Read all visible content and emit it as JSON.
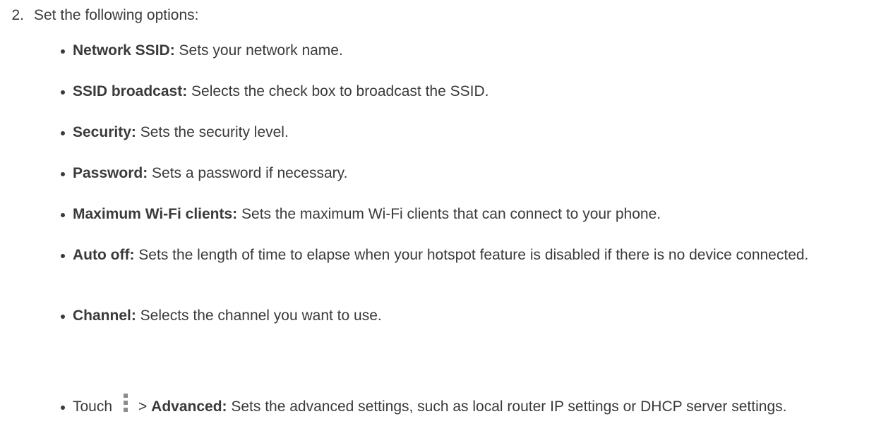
{
  "step": {
    "number": "2.",
    "text": "Set the following options:"
  },
  "options": [
    {
      "term": "Network SSID:",
      "description": " Sets your network name."
    },
    {
      "term": "SSID broadcast:",
      "description": " Selects the check box to broadcast the SSID."
    },
    {
      "term": "Security:",
      "description": " Sets the security level."
    },
    {
      "term": "Password:",
      "description": " Sets a password if necessary."
    },
    {
      "term": "Maximum Wi-Fi clients:",
      "description": " Sets the maximum Wi-Fi clients that can connect to your phone."
    },
    {
      "term": "Auto off:",
      "description": " Sets the length of time to elapse when your hotspot feature is disabled if there is no device connected."
    },
    {
      "term": "Channel:",
      "description": " Selects the channel you want to use."
    }
  ],
  "touch_option": {
    "prefix": "Touch",
    "icon": "more-options-vertical-icon",
    "separator": ">",
    "term": "Advanced:",
    "description": " Sets the advanced settings, such as local router IP settings or DHCP server settings."
  }
}
